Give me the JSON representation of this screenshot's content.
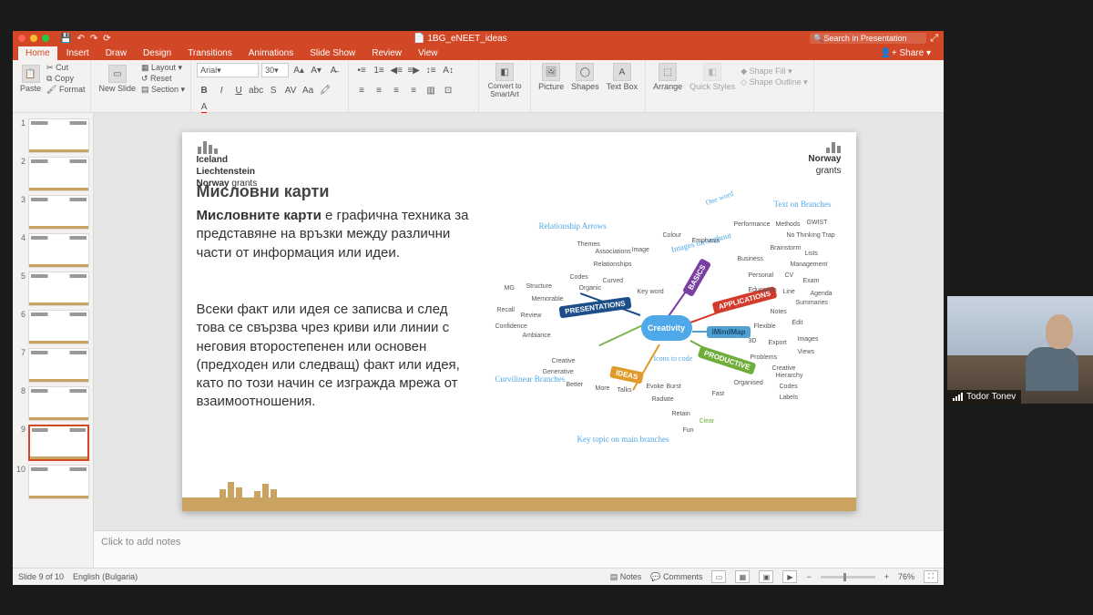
{
  "titlebar": {
    "doc_title": "1BG_eNEET_ideas",
    "search_placeholder": "Search in Presentation",
    "qat": {
      "save": "💾",
      "undo": "↶",
      "redo": "↷",
      "autosave": "⟳"
    }
  },
  "tabs": {
    "items": [
      "Home",
      "Insert",
      "Draw",
      "Design",
      "Transitions",
      "Animations",
      "Slide Show",
      "Review",
      "View"
    ],
    "active": 0,
    "share_label": "Share"
  },
  "ribbon": {
    "paste_label": "Paste",
    "cut_label": "Cut",
    "copy_label": "Copy",
    "format_label": "Format",
    "new_slide_label": "New Slide",
    "layout_label": "Layout",
    "reset_label": "Reset",
    "section_label": "Section",
    "font_name": "Arial",
    "font_size": "30",
    "convert_label": "Convert to SmartArt",
    "picture_label": "Picture",
    "shapes_label": "Shapes",
    "textbox_label": "Text Box",
    "arrange_label": "Arrange",
    "quick_label": "Quick Styles",
    "shape_fill_label": "Shape Fill",
    "shape_outline_label": "Shape Outline"
  },
  "thumbs": {
    "count": 10,
    "selected": 9
  },
  "slide": {
    "grants_left_1": "Iceland",
    "grants_left_2": "Liechtenstein",
    "grants_left_3": "Norway",
    "grants_word": "grants",
    "grants_right": "Norway",
    "title": "Мисловни карти",
    "para1_bold": "Мисловните карти",
    "para1_rest": " е графична техника за представяне на връзки между различни части от информация или идеи.",
    "para2": "Всеки факт или идея се записва и след това се свързва чрез криви или линии с неговия второстепенен или основен (предходен или следващ) факт или идея, като по този начин се изгражда мрежа от взаимоотношения.",
    "mm_center": "Creativity",
    "mm_presentations": "PRESENTATIONS",
    "mm_basics": "BASICS",
    "mm_applications": "APPLICATIONS",
    "mm_imindmap": "iMindMap",
    "mm_productive": "PRODUCTIVE",
    "mm_ideas": "IDEAS",
    "mm_note1": "Relationship Arrows",
    "mm_note2": "Images throughout",
    "mm_note3": "Text on Branches",
    "mm_note4": "Curvilinear Branches",
    "mm_note5": "Key topic on main branches",
    "mm_note6": "Icons to code",
    "mm_note7": "One word",
    "subs": {
      "themes": "Themes",
      "associations": "Associations",
      "image": "Image",
      "relationships": "Relationships",
      "codes": "Codes",
      "curved": "Curved",
      "organic": "Organic",
      "keyword": "Key word",
      "colour": "Colour",
      "emphasis": "Emphasis",
      "performance": "Performance",
      "methods": "Methods",
      "nbt": "No Thinking Trap",
      "brainstorm": "Brainstorm",
      "lists": "Lists",
      "mgmt": "Management",
      "business": "Business",
      "personal": "Personal",
      "cv": "CV",
      "exam": "Exam",
      "education": "Education",
      "agenda": "Agenda",
      "summaries": "Summaries",
      "notes": "Notes",
      "line": "Line",
      "gwist": "GWIST",
      "flexible": "Flexible",
      "3d": "3D",
      "export": "Export",
      "edit": "Edit",
      "images": "Images",
      "views": "Views",
      "productive": "Productive",
      "fast": "Fast",
      "clear": "Clear",
      "fun": "Fun",
      "problems": "Problems",
      "organised": "Organised",
      "creative": "Creative",
      "labels": "Labels",
      "codes2": "Codes",
      "hierarchy": "Hierarchy",
      "retain": "Retain",
      "radiate": "Radiate",
      "more": "More",
      "talks": "Talks",
      "generative": "Generative",
      "creative2": "Creative",
      "better": "Better",
      "evoke": "Evoke",
      "burst": "Burst",
      "structure": "Structure",
      "memorable": "Memorable",
      "confidence": "Confidence",
      "recall": "Recall",
      "review": "Review",
      "mg": "MG",
      "ambiance": "Ambiance"
    }
  },
  "notes": {
    "placeholder": "Click to add notes"
  },
  "status": {
    "slide_info": "Slide 9 of 10",
    "language": "English (Bulgaria)",
    "notes_label": "Notes",
    "comments_label": "Comments",
    "zoom": "76%"
  },
  "webcam": {
    "name": "Todor Tonev"
  }
}
